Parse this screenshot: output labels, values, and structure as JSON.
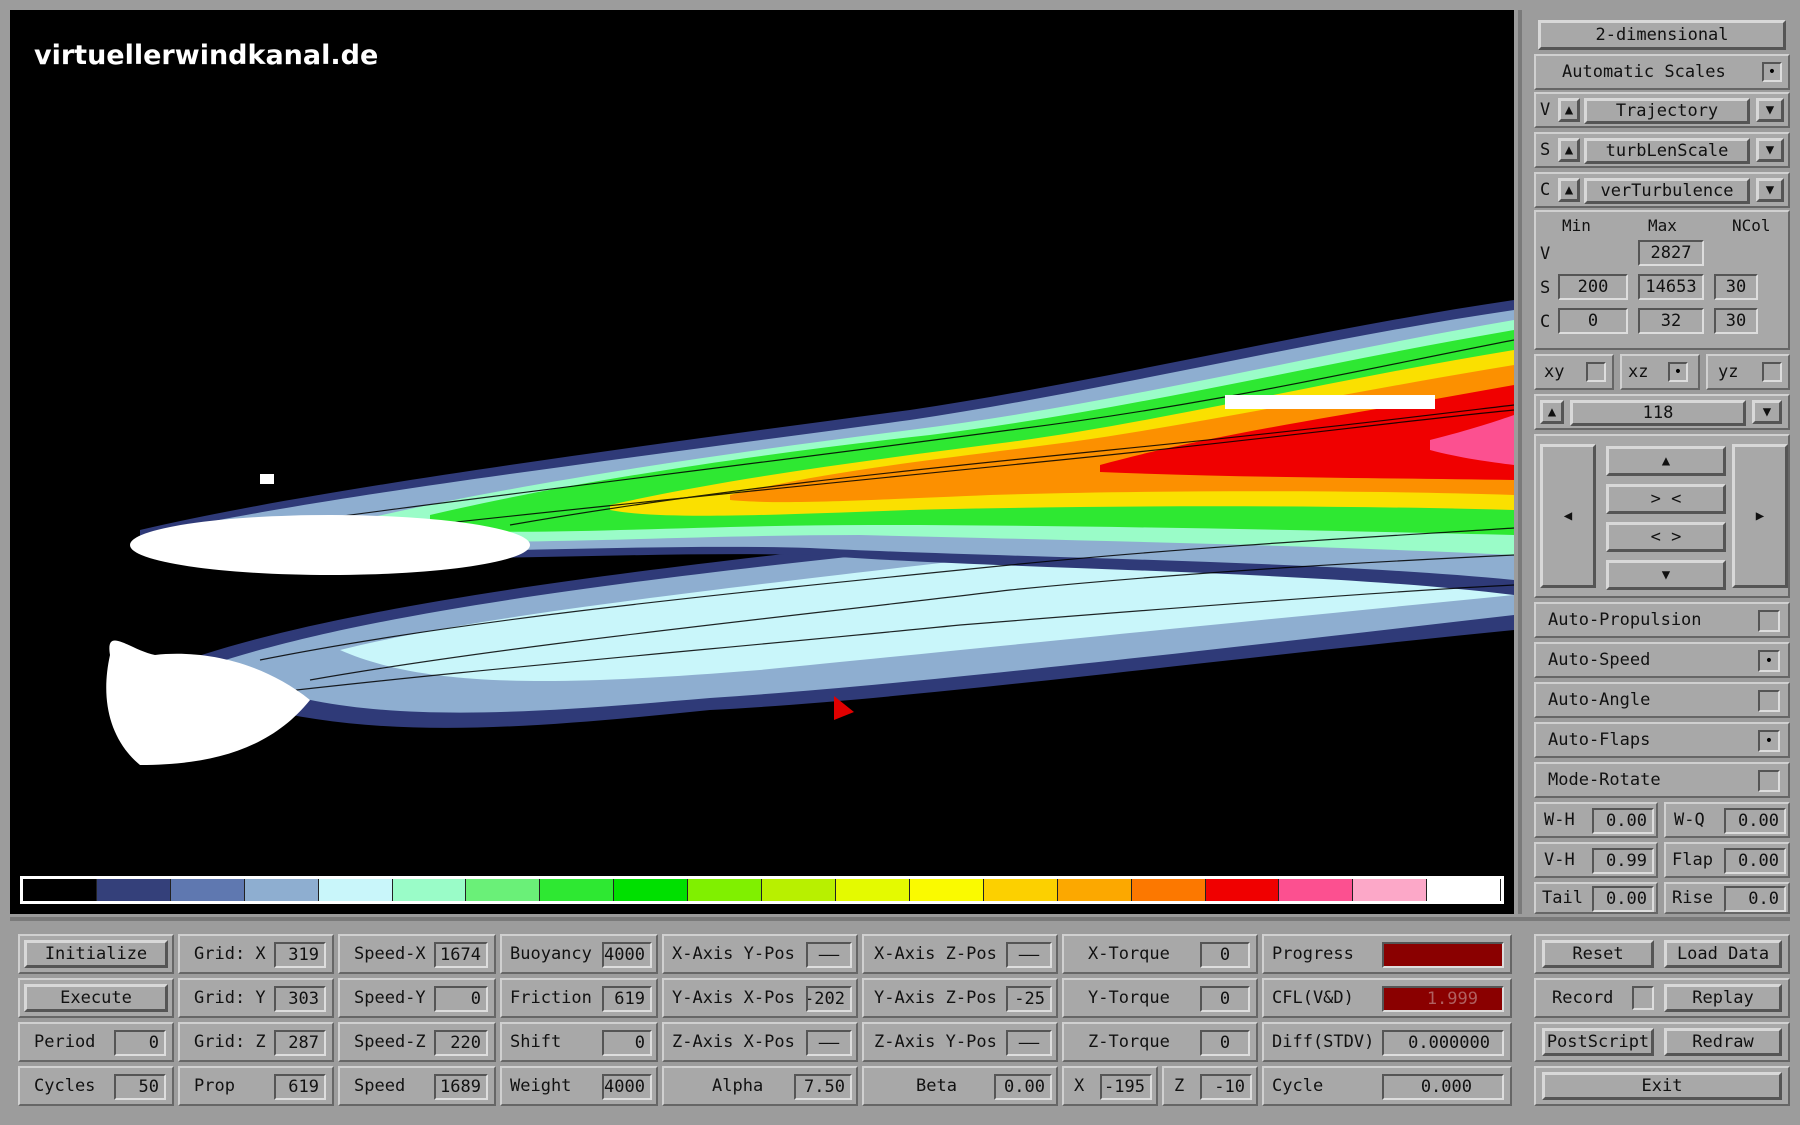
{
  "watermark": "virtuellerwindkanal.de",
  "colors": {
    "legend": [
      "#000000",
      "#34407a",
      "#5f78b0",
      "#8eaed0",
      "#c9f6fa",
      "#9afcc8",
      "#6af078",
      "#2ee832",
      "#00e000",
      "#80f000",
      "#b8f000",
      "#e4fa00",
      "#fafa00",
      "#fcd000",
      "#fca800",
      "#fc7800",
      "#f00000",
      "#fc5090",
      "#fca8c8",
      "#ffffff"
    ],
    "progress_fill": "#8a0000",
    "cfl_fill": "#8a0000"
  },
  "sidebar": {
    "mode_label": "2-dimensional",
    "auto_scales_label": "Automatic Scales",
    "auto_scales_checked": "•",
    "rows": [
      {
        "key": "V",
        "value": "Trajectory"
      },
      {
        "key": "S",
        "value": "turbLenScale"
      },
      {
        "key": "C",
        "value": "verTurbulence"
      }
    ],
    "up_glyph": "▲",
    "down_glyph": "▼",
    "scale_headers": [
      "Min",
      "Max",
      "NCol"
    ],
    "scale_rows": [
      {
        "key": "V",
        "min": "",
        "max": "2827",
        "ncol": ""
      },
      {
        "key": "S",
        "min": "200",
        "max": "14653",
        "ncol": "30"
      },
      {
        "key": "C",
        "min": "0",
        "max": "32",
        "ncol": "30"
      }
    ],
    "planes": [
      {
        "label": "xy",
        "mark": ""
      },
      {
        "label": "xz",
        "mark": "•"
      },
      {
        "label": "yz",
        "mark": ""
      }
    ],
    "slice_value": "118",
    "nav": {
      "left": "◀",
      "right": "▶",
      "up": "▲",
      "down": "▼",
      "zoom_in": "> <",
      "zoom_out": "< >"
    },
    "toggles": [
      {
        "label": "Auto-Propulsion",
        "mark": ""
      },
      {
        "label": "Auto-Speed",
        "mark": "•"
      },
      {
        "label": "Auto-Angle",
        "mark": ""
      },
      {
        "label": "Auto-Flaps",
        "mark": "•"
      },
      {
        "label": "Mode-Rotate",
        "mark": ""
      }
    ],
    "params": [
      {
        "label": "W-H",
        "value": "0.00"
      },
      {
        "label": "W-Q",
        "value": "0.00"
      },
      {
        "label": "V-H",
        "value": "0.99"
      },
      {
        "label": "Flap",
        "value": "0.00"
      },
      {
        "label": "Tail",
        "value": "0.00"
      },
      {
        "label": "Rise",
        "value": "0.0"
      }
    ]
  },
  "bottom": {
    "buttons": [
      "Initialize",
      "Execute"
    ],
    "period": {
      "label": "Period",
      "value": "0"
    },
    "cycles": {
      "label": "Cycles",
      "value": "50"
    },
    "grid": [
      {
        "label": "Grid: X",
        "value": "319"
      },
      {
        "label": "Grid: Y",
        "value": "303"
      },
      {
        "label": "Grid: Z",
        "value": "287"
      },
      {
        "label": "Prop",
        "value": "619"
      }
    ],
    "speed": [
      {
        "label": "Speed-X",
        "value": "1674"
      },
      {
        "label": "Speed-Y",
        "value": "0"
      },
      {
        "label": "Speed-Z",
        "value": "220"
      },
      {
        "label": "Speed",
        "value": "1689"
      }
    ],
    "forces": [
      {
        "label": "Buoyancy",
        "value": "4000"
      },
      {
        "label": "Friction",
        "value": "619"
      },
      {
        "label": "Shift",
        "value": "0"
      },
      {
        "label": "Weight",
        "value": "4000"
      }
    ],
    "axes_a": [
      {
        "label": "X-Axis Y-Pos",
        "value": "——"
      },
      {
        "label": "Y-Axis X-Pos",
        "value": "-202"
      },
      {
        "label": "Z-Axis X-Pos",
        "value": "——"
      }
    ],
    "alpha": {
      "label": "Alpha",
      "value": "7.50"
    },
    "axes_b": [
      {
        "label": "X-Axis Z-Pos",
        "value": "——"
      },
      {
        "label": "Y-Axis Z-Pos",
        "value": "-25"
      },
      {
        "label": "Z-Axis Y-Pos",
        "value": "——"
      }
    ],
    "beta": {
      "label": "Beta",
      "value": "0.00"
    },
    "torque": [
      {
        "label": "X-Torque",
        "value": "0"
      },
      {
        "label": "Y-Torque",
        "value": "0"
      },
      {
        "label": "Z-Torque",
        "value": "0"
      }
    ],
    "x_pos": {
      "label": "X",
      "value": "-195"
    },
    "z_pos": {
      "label": "Z",
      "value": "-10"
    },
    "status": {
      "progress_label": "Progress",
      "cfl_label": "CFL(V&D)",
      "cfl_value": "1.999",
      "diff_label": "Diff(STDV)",
      "diff_value": "0.000000",
      "cycle_label": "Cycle",
      "cycle_value": "0.000"
    },
    "actions": {
      "reset": "Reset",
      "load": "Load Data",
      "record": "Record",
      "replay": "Replay",
      "postscript": "PostScript",
      "redraw": "Redraw",
      "exit": "Exit"
    }
  }
}
